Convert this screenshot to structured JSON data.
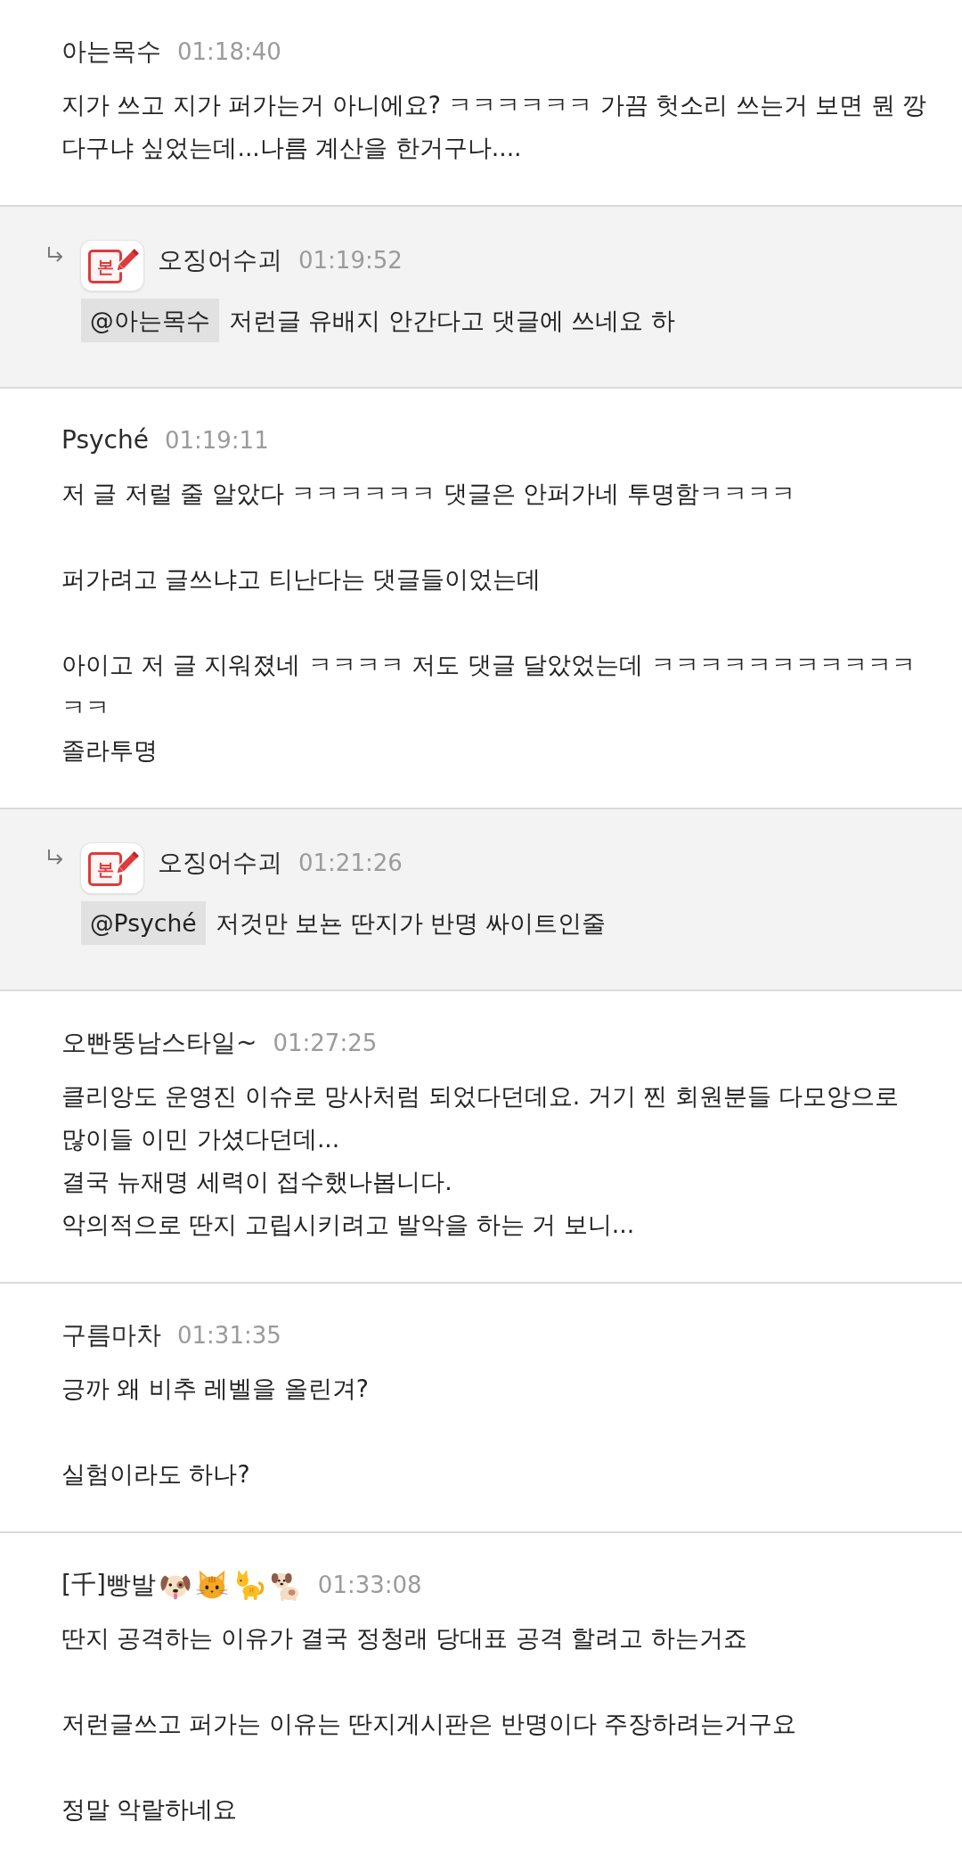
{
  "comments": [
    {
      "kind": "comment",
      "author": "아는목수",
      "time": "01:18:40",
      "text": "지가 쓰고 지가 퍼가는거 아니에요? ㅋㅋㅋㅋㅋㅋ 가끔 헛소리 쓰는거 보면 뭔 깡다구냐 싶었는데...나름 계산을 한거구나...."
    },
    {
      "kind": "reply",
      "badge": "본",
      "author": "오징어수괴",
      "time": "01:19:52",
      "mention": "@아는목수",
      "text": "저런글 유배지 안간다고 댓글에 쓰네요 하"
    },
    {
      "kind": "comment",
      "author": "Psyché",
      "time": "01:19:11",
      "text": "저 글 저럴 줄 알았다 ㅋㅋㅋㅋㅋㅋ 댓글은 안퍼가네 투명함ㅋㅋㅋㅋ\n\n퍼가려고 글쓰냐고 티난다는 댓글들이었는데\n\n아이고 저 글 지워졌네 ㅋㅋㅋㅋ 저도 댓글 달았었는데 ㅋㅋㅋㅋㅋㅋㅋㅋㅋㅋㅋㅋㅋ\n졸라투명"
    },
    {
      "kind": "reply",
      "badge": "본",
      "author": "오징어수괴",
      "time": "01:21:26",
      "mention": "@Psyché",
      "text": "저것만 보뇬 딴지가 반명 싸이트인줄"
    },
    {
      "kind": "comment",
      "author": "오빤뚱남스타일~",
      "time": "01:27:25",
      "text": "클리앙도 운영진 이슈로 망사처럼 되었다던데요. 거기 찐 회원분들 다모앙으로 많이들 이민 가셨다던데...\n결국 뉴재명 세력이 접수했나봅니다.\n악의적으로 딴지 고립시키려고 발악을 하는 거 보니..."
    },
    {
      "kind": "comment",
      "author": "구름마차",
      "time": "01:31:35",
      "text": "긍까 왜 비추 레벨을 올린겨?\n\n실험이라도 하나?"
    },
    {
      "kind": "comment",
      "author": "[千]빵발",
      "name_icons": [
        {
          "kind": "dog-face"
        },
        {
          "kind": "cat-face"
        },
        {
          "kind": "cat"
        },
        {
          "kind": "dog"
        }
      ],
      "time": "01:33:08",
      "text": "딴지 공격하는 이유가 결국 정청래 당대표 공격 할려고 하는거죠\n\n저런글쓰고 퍼가는 이유는 딴지게시판은 반명이다 주장하려는거구요\n\n정말 악랄하네요"
    }
  ]
}
